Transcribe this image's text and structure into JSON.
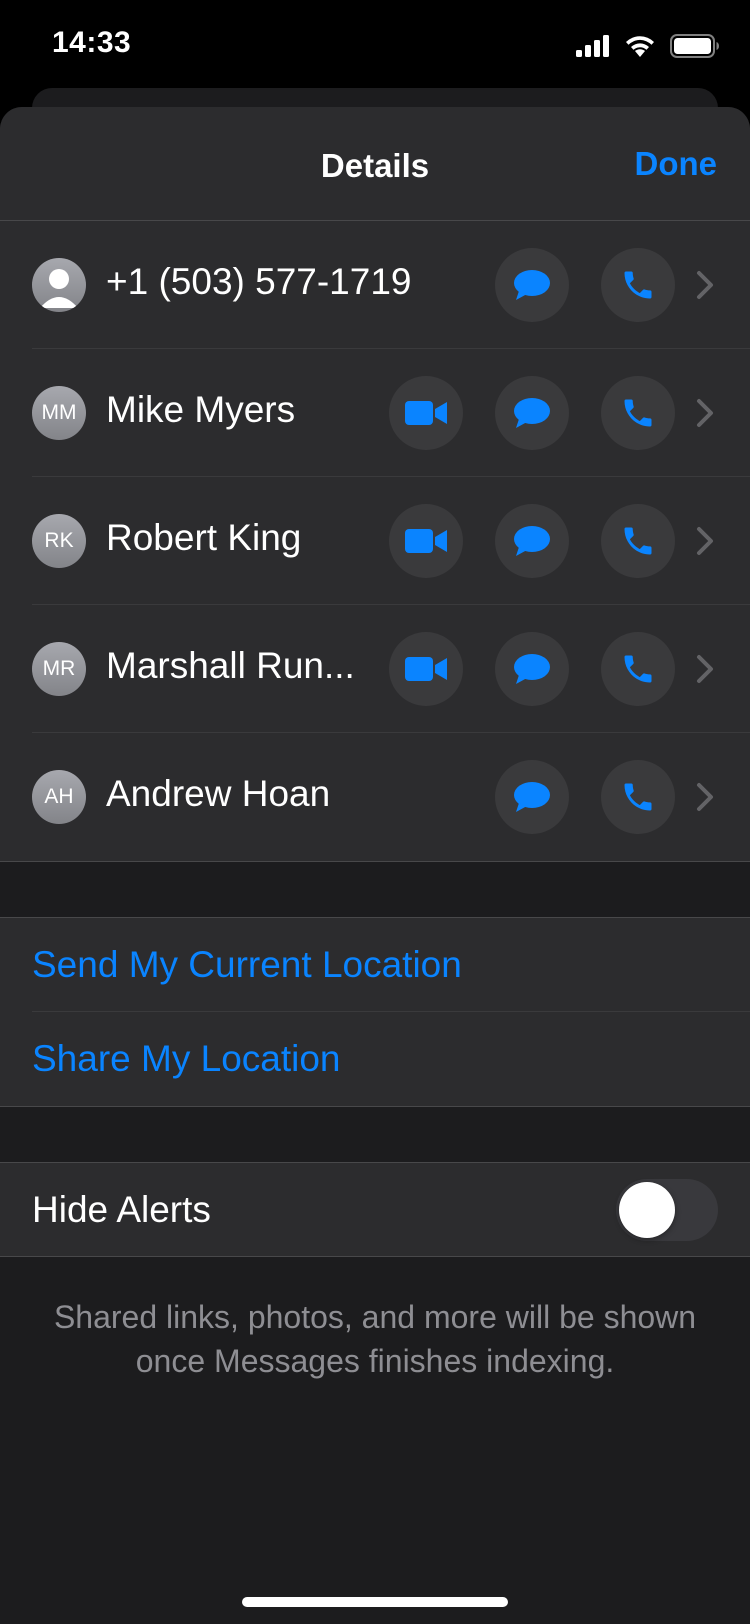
{
  "status_bar": {
    "time": "14:33",
    "icons": [
      "cellular-signal-icon",
      "wifi-icon",
      "battery-icon"
    ]
  },
  "header": {
    "title": "Details",
    "done_label": "Done"
  },
  "colors": {
    "accent": "#0a84ff",
    "sheet_background": "#1c1c1e",
    "group_background": "#2c2c2e",
    "button_background": "#3a3a3c",
    "secondary_text": "#8e8e93"
  },
  "contacts": [
    {
      "avatar_initials": "",
      "avatar_icon": "person-silhouette-icon",
      "name": "+1 (503) 577-1719",
      "actions": [
        "message",
        "phone"
      ]
    },
    {
      "avatar_initials": "MM",
      "name": "Mike Myers",
      "actions": [
        "video",
        "message",
        "phone"
      ]
    },
    {
      "avatar_initials": "RK",
      "name": "Robert King",
      "actions": [
        "video",
        "message",
        "phone"
      ]
    },
    {
      "avatar_initials": "MR",
      "name": "Marshall Run...",
      "actions": [
        "video",
        "message",
        "phone"
      ]
    },
    {
      "avatar_initials": "AH",
      "name": "Andrew Hoan",
      "actions": [
        "message",
        "phone"
      ]
    }
  ],
  "location": {
    "send_current_label": "Send My Current Location",
    "share_label": "Share My Location"
  },
  "alerts": {
    "label": "Hide Alerts",
    "enabled": false
  },
  "footer_note": "Shared links, photos, and more will be shown once Messages finishes indexing."
}
